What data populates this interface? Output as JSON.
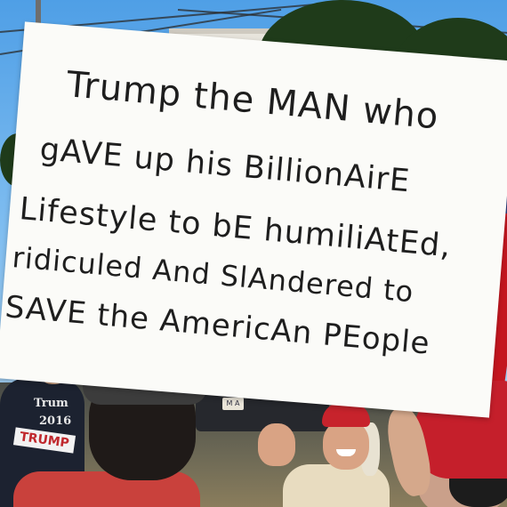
{
  "sign": {
    "lines": [
      "Trump the MAN who",
      "gAVE up his BillionAirE",
      "Lifestyle to bE humiliAtEd,",
      "ridiculed And SlAndered to",
      "SAVE the AmericAn PEople"
    ]
  },
  "background": {
    "shirt_lines": [
      "Trum",
      "2016"
    ],
    "shirt_banner": "TRUMP",
    "plate_text": "M A"
  },
  "colors": {
    "sign_bg": "#fbfbf8",
    "ink": "#1e1e1e",
    "sky": "#6fb0e8",
    "red_cap": "#c7232c"
  }
}
